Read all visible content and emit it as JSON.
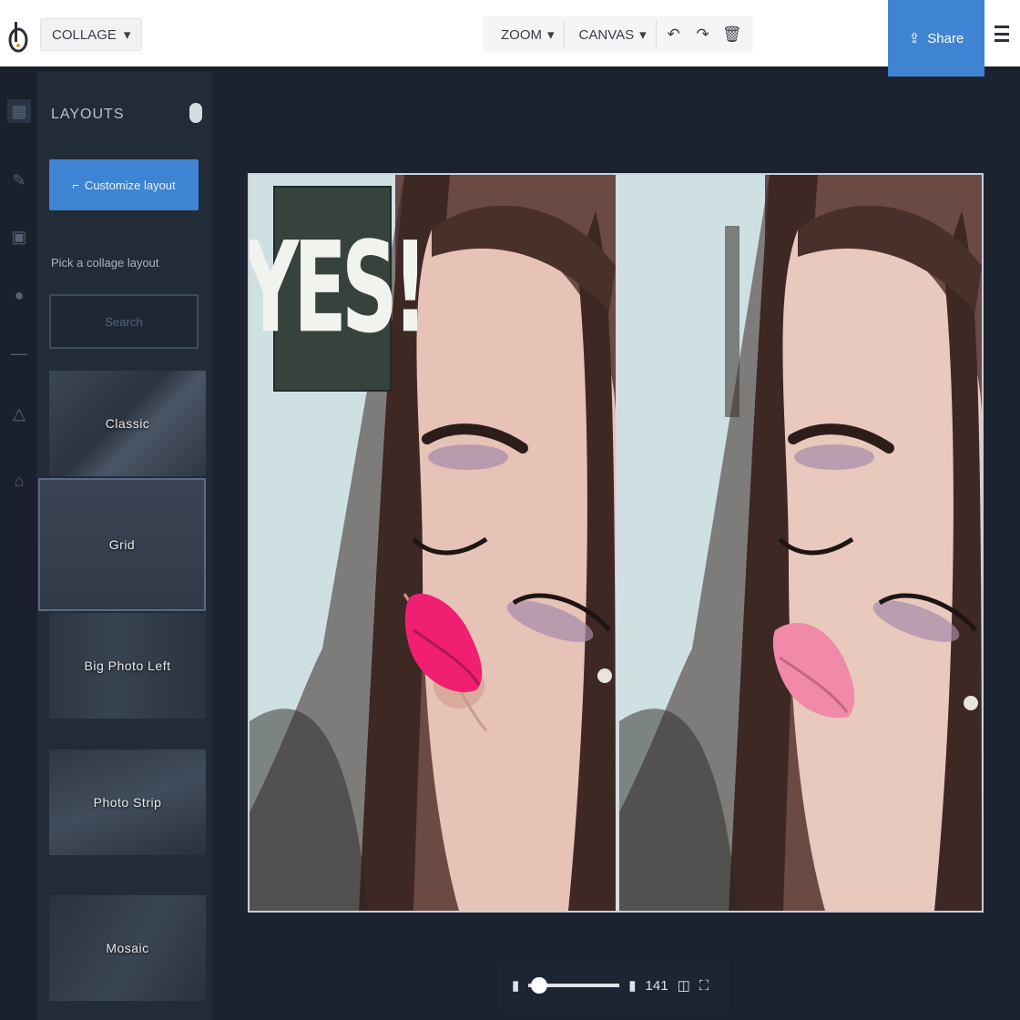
{
  "topbar": {
    "project_label": "COLLAGE",
    "dropdown1": "ZOOM",
    "dropdown2": "CANVAS",
    "tool_icons": [
      "undo-icon",
      "redo-icon",
      "delete-icon"
    ],
    "download_label": "Share",
    "accent": "#3f84d3"
  },
  "panel": {
    "title": "LAYOUTS",
    "primary_button": "Customize layout",
    "hint": "Pick a collage layout",
    "input_value": "Search",
    "tiles": [
      "Classic",
      "Grid",
      "Big Photo Left",
      "Photo Strip",
      "Mosaic"
    ]
  },
  "canvas": {
    "sign_text": "YES!"
  },
  "zoom": {
    "value": "141",
    "fraction": 0.12
  }
}
